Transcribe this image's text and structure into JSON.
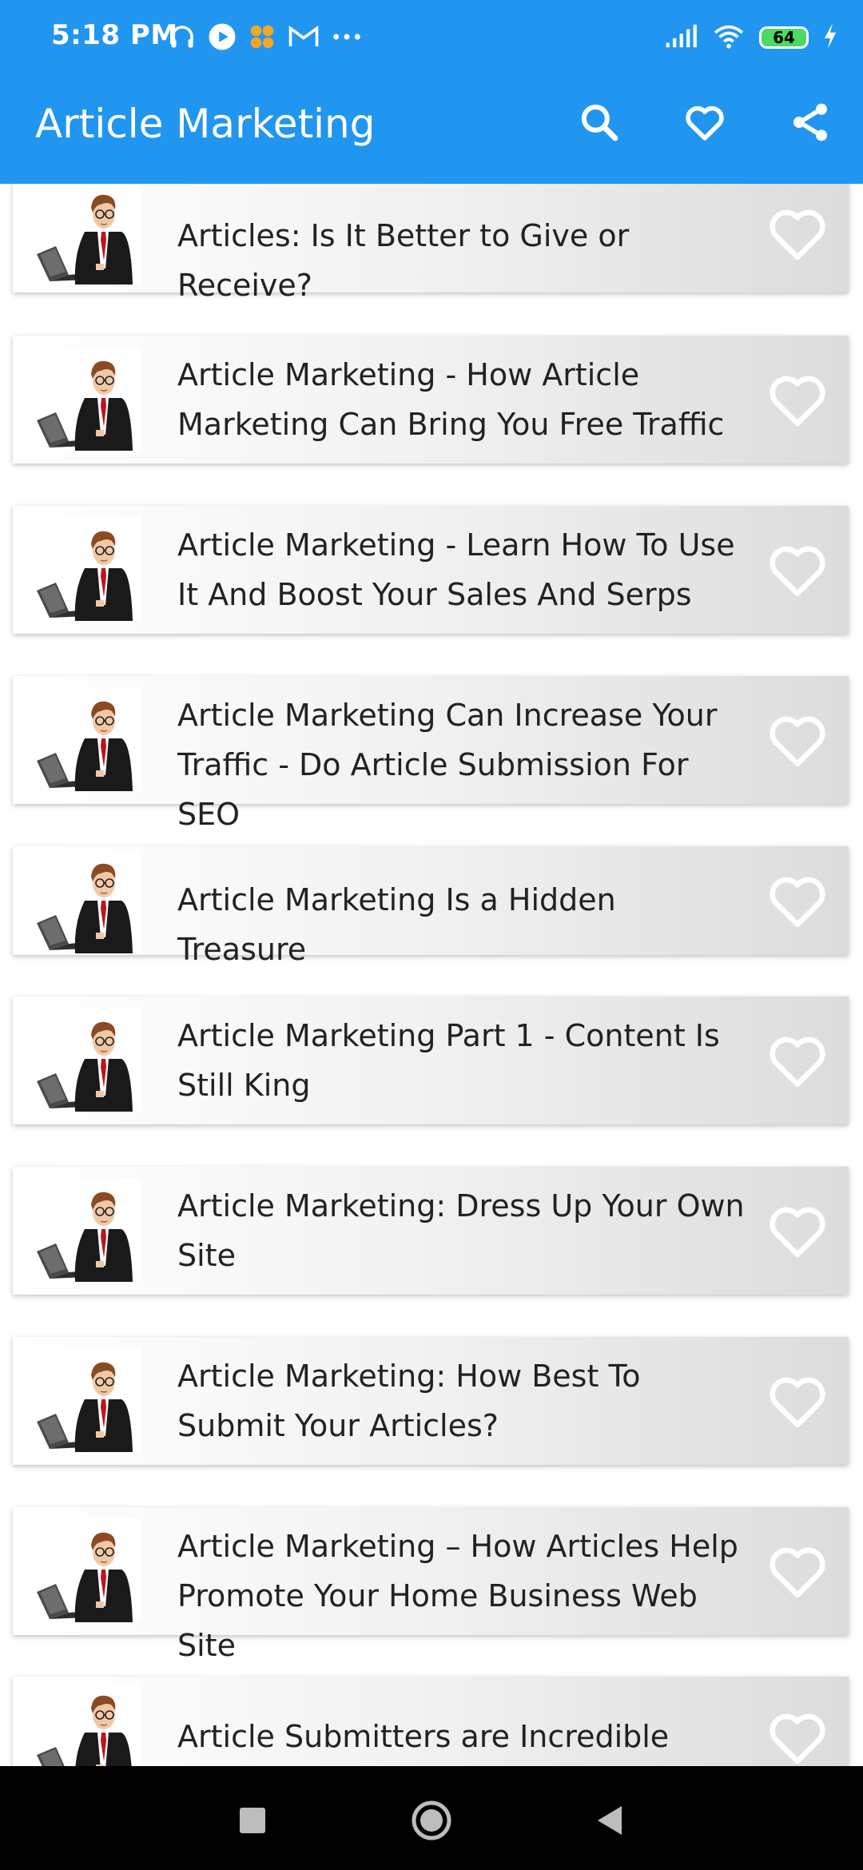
{
  "status_bar": {
    "time": "5:18 PM",
    "battery": "64"
  },
  "app_bar": {
    "title": "Article Marketing"
  },
  "colors": {
    "primary": "#2196f0",
    "heart": "#ffffff"
  },
  "articles": [
    {
      "title": "Articles: Is It Better to Give or Receive?"
    },
    {
      "title": "Article Marketing - How Article Marketing Can Bring You Free Traffic"
    },
    {
      "title": "Article Marketing - Learn How To Use It And Boost Your Sales And Serps"
    },
    {
      "title": "Article Marketing Can Increase Your Traffic - Do Article Submission For SEO"
    },
    {
      "title": "Article Marketing Is a Hidden Treasure"
    },
    {
      "title": "Article Marketing Part 1 - Content Is Still King"
    },
    {
      "title": "Article Marketing: Dress Up Your Own Site"
    },
    {
      "title": "Article Marketing: How Best To Submit Your Articles?"
    },
    {
      "title": "Article Marketing – How Articles Help Promote Your Home Business Web Site"
    },
    {
      "title": "Article Submitters are Incredible"
    }
  ]
}
